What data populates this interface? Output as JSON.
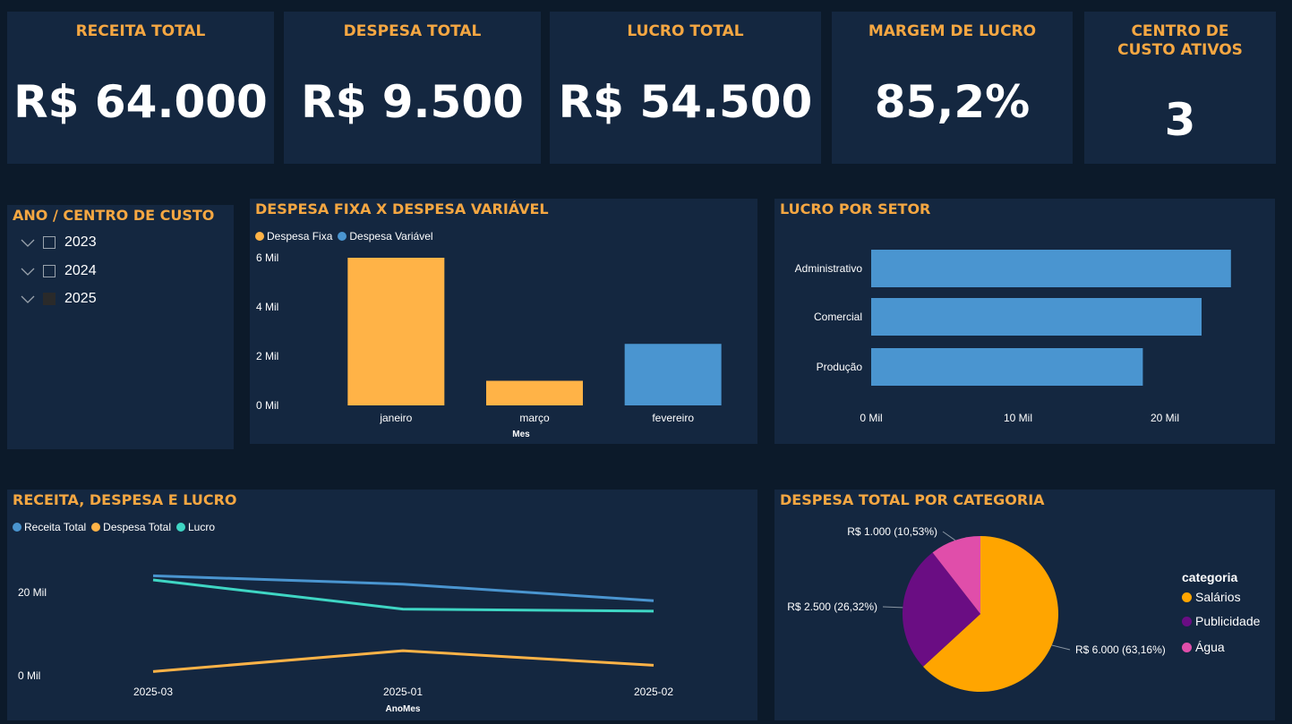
{
  "kpis": [
    {
      "title": "RECEITA TOTAL",
      "value": "R$ 64.000"
    },
    {
      "title": "DESPESA TOTAL",
      "value": "R$ 9.500"
    },
    {
      "title": "LUCRO TOTAL",
      "value": "R$ 54.500"
    },
    {
      "title": "MARGEM DE LUCRO",
      "value": "85,2%"
    },
    {
      "title": "CENTRO DE CUSTO ATIVOS",
      "value": "3"
    }
  ],
  "slicer": {
    "title": "ANO / CENTRO DE CUSTO",
    "items": [
      {
        "label": "2023",
        "checked": false
      },
      {
        "label": "2024",
        "checked": false
      },
      {
        "label": "2025",
        "checked": true
      }
    ]
  },
  "chart_data": [
    {
      "id": "despesa-fixa-variavel",
      "type": "bar",
      "title": "DESPESA FIXA X DESPESA VARIÁVEL",
      "xlabel": "Mes",
      "ylabel": "",
      "categories": [
        "janeiro",
        "março",
        "fevereiro"
      ],
      "series": [
        {
          "name": "Despesa Fixa",
          "color": "#ffb347",
          "values": [
            6000,
            1000,
            null
          ]
        },
        {
          "name": "Despesa Variável",
          "color": "#4a95d0",
          "values": [
            null,
            null,
            2500
          ]
        }
      ],
      "yticks": [
        "0 Mil",
        "2 Mil",
        "4 Mil",
        "6 Mil"
      ],
      "ylim": [
        0,
        6000
      ],
      "legend": "top-left"
    },
    {
      "id": "lucro-por-setor",
      "type": "bar",
      "orientation": "horizontal",
      "title": "LUCRO POR SETOR",
      "categories": [
        "Administrativo",
        "Comercial",
        "Produção"
      ],
      "values": [
        24500,
        22500,
        18500
      ],
      "color": "#4a95d0",
      "xticks": [
        "0 Mil",
        "10 Mil",
        "20 Mil"
      ],
      "xlim": [
        0,
        25000
      ]
    },
    {
      "id": "receita-despesa-lucro",
      "type": "line",
      "title": "RECEITA, DESPESA E LUCRO",
      "xlabel": "AnoMes",
      "categories": [
        "2025-03",
        "2025-01",
        "2025-02"
      ],
      "series": [
        {
          "name": "Receita Total",
          "color": "#4a95d0",
          "values": [
            24000,
            22000,
            18000
          ]
        },
        {
          "name": "Despesa Total",
          "color": "#ffb347",
          "values": [
            1000,
            6000,
            2500
          ]
        },
        {
          "name": "Lucro",
          "color": "#3fd6c4",
          "values": [
            23000,
            16000,
            15500
          ]
        }
      ],
      "yticks": [
        "0 Mil",
        "20 Mil"
      ],
      "ylim": [
        0,
        28000
      ],
      "legend": "top-left"
    },
    {
      "id": "despesa-por-categoria",
      "type": "pie",
      "title": "DESPESA TOTAL POR CATEGORIA",
      "legend_title": "categoria",
      "slices": [
        {
          "label": "Salários",
          "value": 6000,
          "text": "R$ 6.000 (63,16%)",
          "color": "#ffa500"
        },
        {
          "label": "Publicidade",
          "value": 2500,
          "text": "R$ 2.500 (26,32%)",
          "color": "#6a0d83"
        },
        {
          "label": "Água",
          "value": 1000,
          "text": "R$ 1.000 (10,53%)",
          "color": "#e04eaa"
        }
      ],
      "legend": "right"
    }
  ]
}
